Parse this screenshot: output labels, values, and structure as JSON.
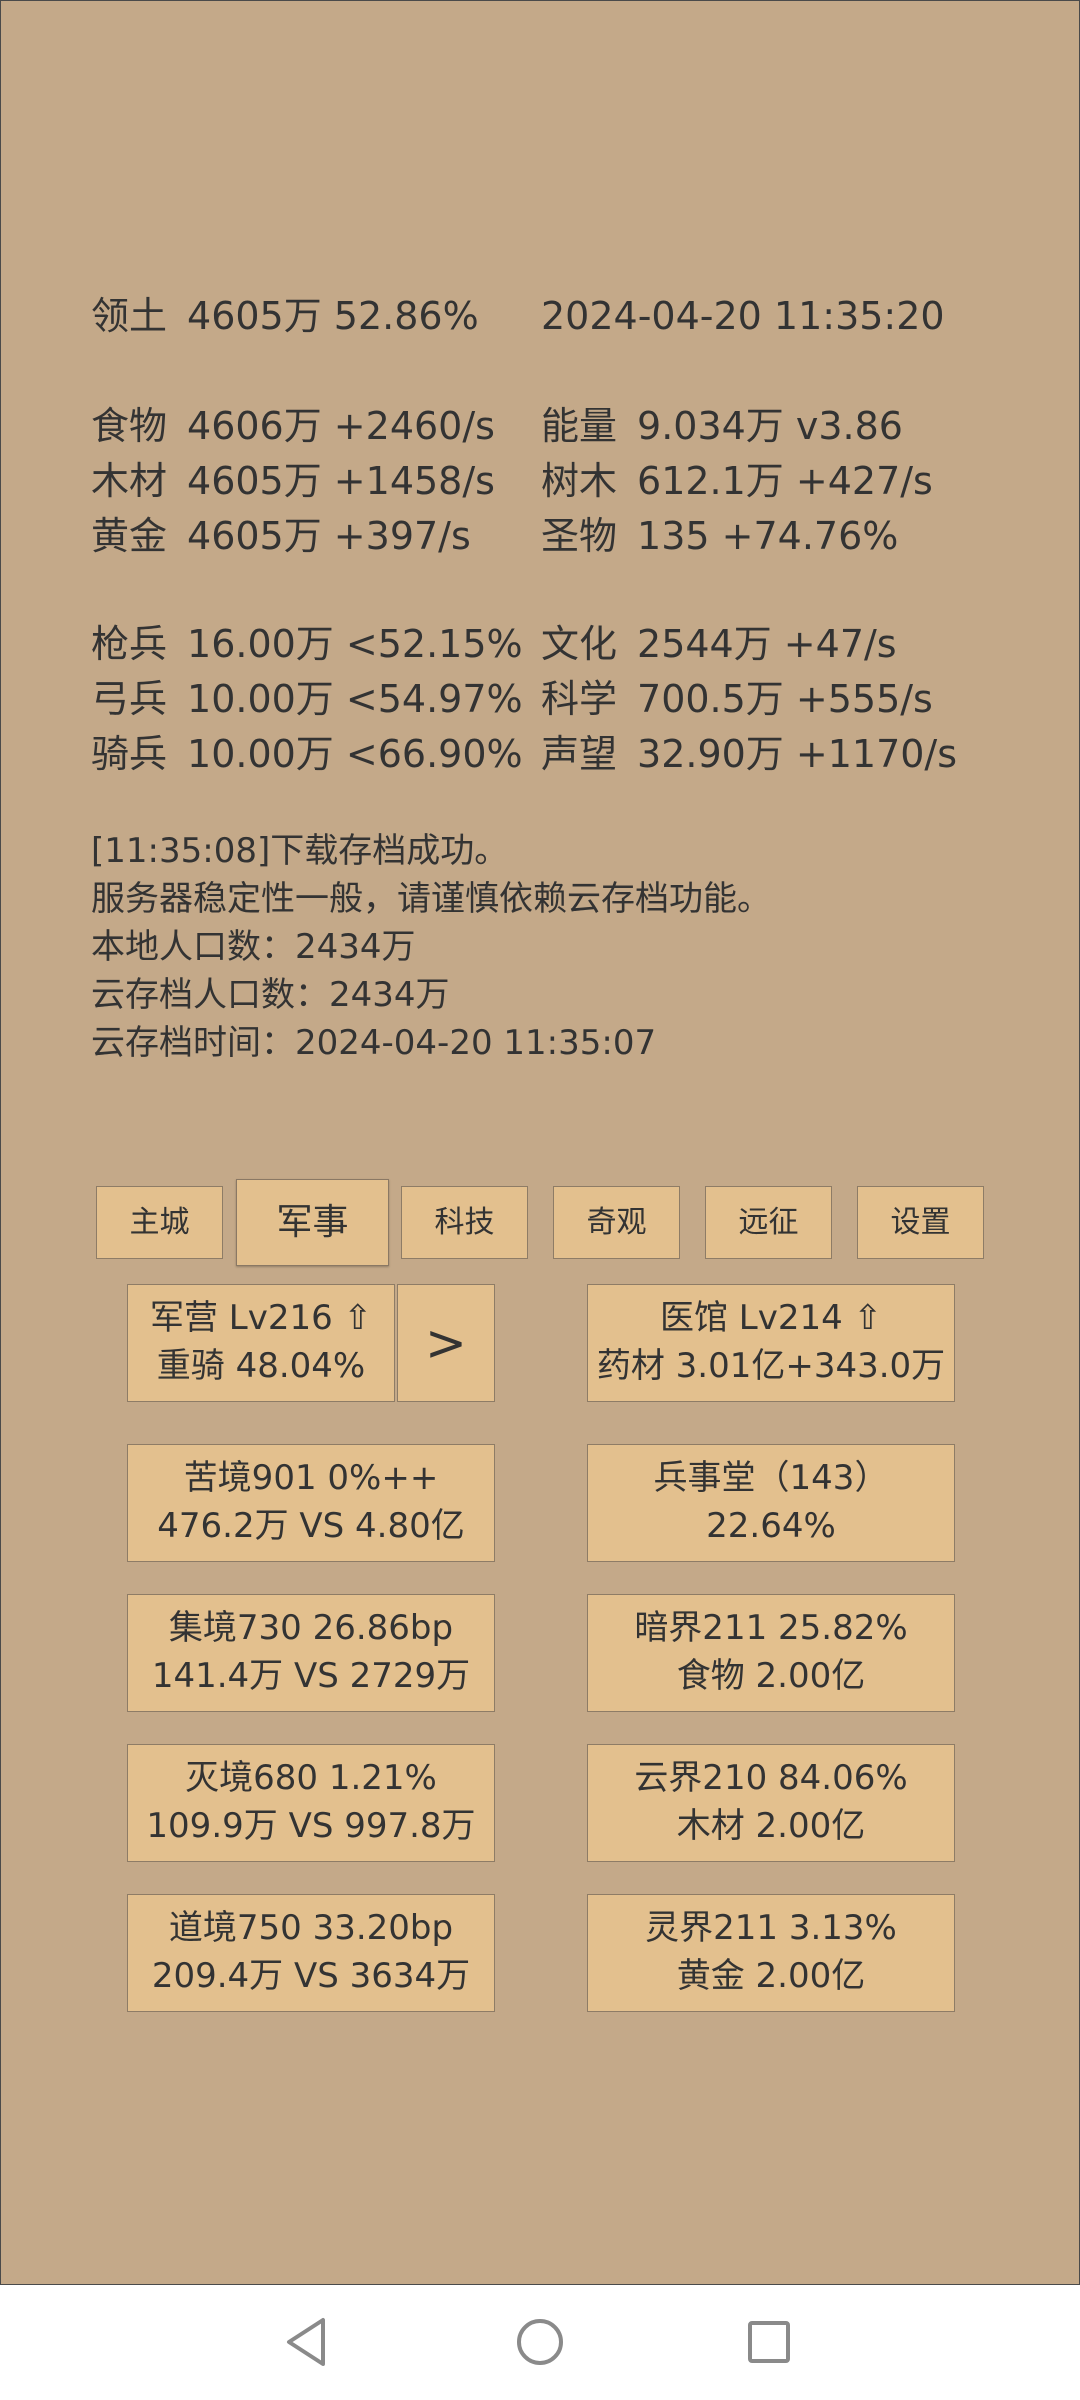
{
  "stats": {
    "territory": {
      "label": "领土",
      "value": "4605万  52.86%"
    },
    "datetime": "2024-04-20 11:35:20",
    "left": [
      {
        "label": "食物",
        "value": "4606万 +2460/s"
      },
      {
        "label": "木材",
        "value": "4605万 +1458/s"
      },
      {
        "label": "黄金",
        "value": "4605万 +397/s"
      }
    ],
    "right": [
      {
        "label": "能量",
        "value": "9.034万  v3.86"
      },
      {
        "label": "树木",
        "value": "612.1万 +427/s"
      },
      {
        "label": "圣物",
        "value": "135 +74.76%"
      }
    ],
    "troops": [
      {
        "label": "枪兵",
        "value": "16.00万 <52.15%"
      },
      {
        "label": "弓兵",
        "value": "10.00万 <54.97%"
      },
      {
        "label": "骑兵",
        "value": "10.00万 <66.90%"
      }
    ],
    "culture": [
      {
        "label": "文化",
        "value": "2544万 +47/s"
      },
      {
        "label": "科学",
        "value": "700.5万 +555/s"
      },
      {
        "label": "声望",
        "value": "32.90万 +1170/s"
      }
    ]
  },
  "log": [
    "[11:35:08]下载存档成功。",
    "服务器稳定性一般，请谨慎依赖云存档功能。",
    "本地人口数：2434万",
    "云存档人口数：2434万",
    "云存档时间：2024-04-20 11:35:07"
  ],
  "tabs": [
    {
      "id": "main-city",
      "label": "主城"
    },
    {
      "id": "military",
      "label": "军事"
    },
    {
      "id": "tech",
      "label": "科技"
    },
    {
      "id": "wonders",
      "label": "奇观"
    },
    {
      "id": "expedition",
      "label": "远征"
    },
    {
      "id": "settings",
      "label": "设置"
    }
  ],
  "active_tab": "军事",
  "barracks": {
    "line1": "军营 Lv216 ⇧",
    "line2": "重骑 48.04%"
  },
  "arrow_label": ">",
  "hospital": {
    "line1": "医馆 Lv214 ⇧",
    "line2": "药材 3.01亿+343.0万"
  },
  "left_cards": [
    {
      "line1": "苦境901  0%++",
      "line2": "476.2万 VS 4.80亿"
    },
    {
      "line1": "集境730  26.86bp",
      "line2": "141.4万 VS 2729万"
    },
    {
      "line1": "灭境680  1.21%",
      "line2": "109.9万 VS 997.8万"
    },
    {
      "line1": "道境750  33.20bp",
      "line2": "209.4万 VS 3634万"
    }
  ],
  "right_cards": [
    {
      "line1": "兵事堂（143）",
      "line2": "22.64%"
    },
    {
      "line1": "暗界211  25.82%",
      "line2": "食物 2.00亿"
    },
    {
      "line1": "云界210  84.06%",
      "line2": "木材 2.00亿"
    },
    {
      "line1": "灵界211  3.13%",
      "line2": "黄金 2.00亿"
    }
  ],
  "navbar": {
    "icons": [
      "back-triangle-icon",
      "home-circle-icon",
      "recents-square-icon"
    ]
  }
}
